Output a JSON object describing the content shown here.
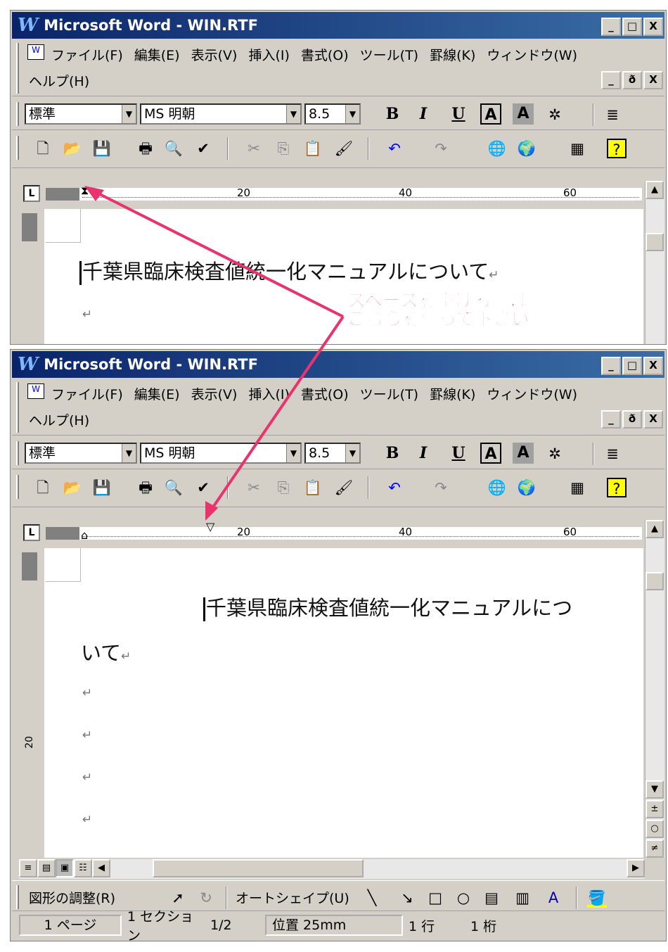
{
  "window_title": "Microsoft Word - WIN.RTF",
  "title_buttons": [
    "_",
    "□",
    "X"
  ],
  "menu": [
    "ファイル(F)",
    "編集(E)",
    "表示(V)",
    "挿入(I)",
    "書式(O)",
    "ツール(T)",
    "罫線(K)",
    "ウィンドウ(W)"
  ],
  "menu_help": "ヘルプ(H)",
  "doc_buttons": [
    "_",
    "ð",
    "X"
  ],
  "style_value": "標準",
  "font_value": "MS 明朝",
  "size_value": "8.5",
  "format_buttons": [
    "B",
    "I",
    "U",
    "A",
    "A"
  ],
  "ruler_labels": [
    "20",
    "40",
    "60"
  ],
  "vruler_label": "20",
  "doc_text": "千葉県臨床検査値統一化マニュアルについて",
  "doc_text_line1": "千葉県臨床検査値統一化マニュアルにつ",
  "doc_text_line2": "いて",
  "annotation_line1": "スペースを空ける際は",
  "annotation_line2": "こちらを使って下さい",
  "drawing_toolbar": {
    "adjust": "図形の調整(R)",
    "autoshape": "オートシェイプ(U)"
  },
  "status": {
    "page": "1 ページ",
    "section": "1 セクション",
    "pages": "1/2",
    "position": "位置 25mm",
    "line": "1 行",
    "column": "1 桁"
  },
  "colors": {
    "titlebar": "#0a246a",
    "annotation": "#e8336d"
  }
}
